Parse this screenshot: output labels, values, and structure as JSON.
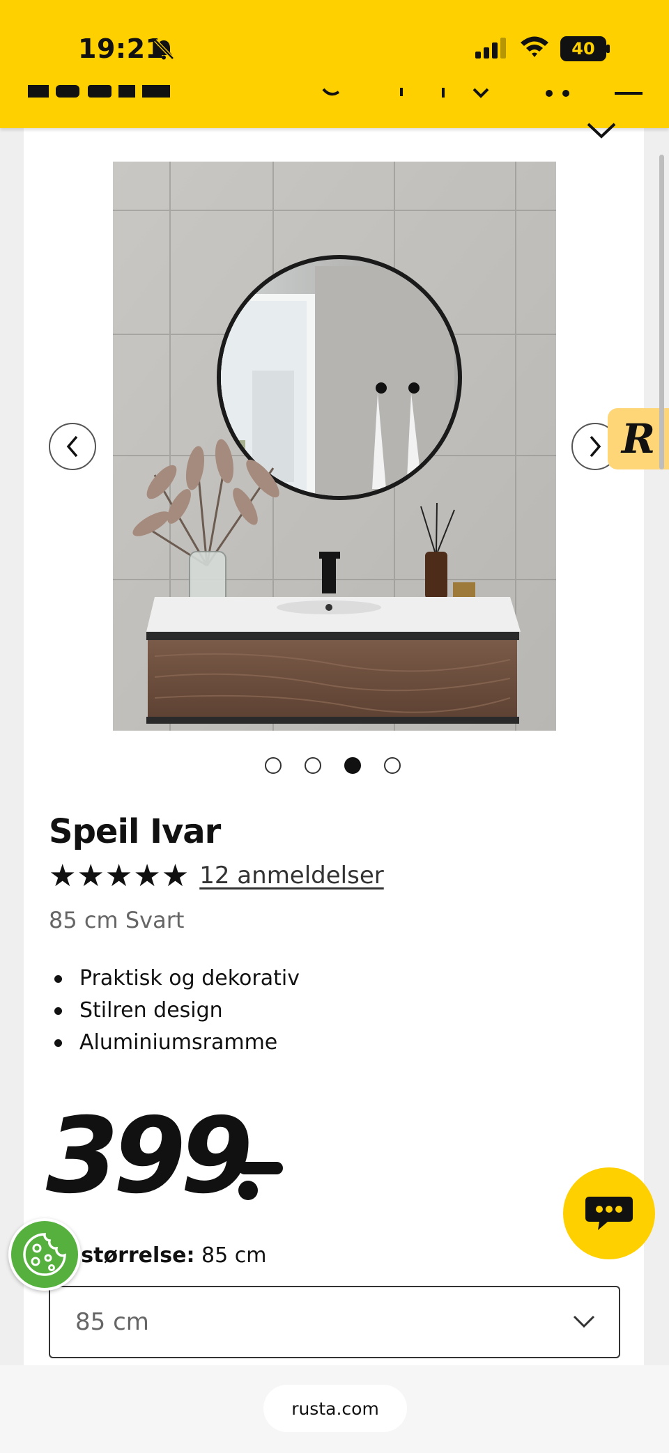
{
  "status_bar": {
    "time": "19:21",
    "battery": "40",
    "icons": [
      "bell-slash-icon",
      "cellular-signal-icon",
      "wifi-icon",
      "battery-icon"
    ]
  },
  "header": {
    "brand": "RUSTA",
    "icons": [
      "search-icon",
      "location-icon",
      "heart-icon",
      "cart-icon",
      "menu-icon"
    ]
  },
  "colors": {
    "brand_yellow": "#ffd000",
    "badge_yellow": "#ffd677",
    "cookie_green": "#56b03e",
    "text": "#111111",
    "muted": "#666666"
  },
  "gallery": {
    "image_count": 4,
    "active_index": 2,
    "prev_icon": "chevron-left-icon",
    "next_icon": "chevron-right-icon"
  },
  "side_badge": {
    "letter": "R"
  },
  "product": {
    "title": "Speil Ivar",
    "stars": "★★★★★",
    "rating": 5,
    "reviews": "12 anmeldelser",
    "variant": "85 cm Svart",
    "features": [
      "Praktisk og dekorativ",
      "Stilren design",
      "Aluminiumsramme"
    ],
    "price": "399"
  },
  "size_selector": {
    "label": "gt størrelse:",
    "value_text": "85 cm",
    "selected": "85 cm"
  },
  "browser": {
    "url": "rusta.com"
  }
}
